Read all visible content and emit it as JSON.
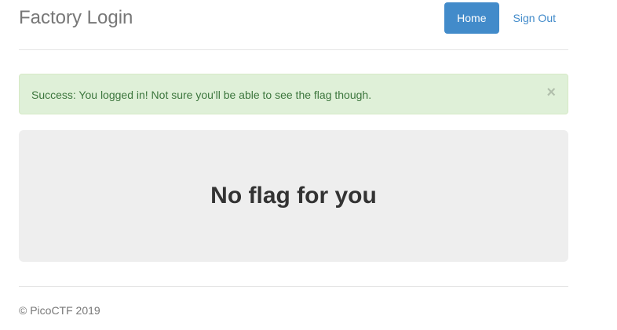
{
  "header": {
    "title": "Factory Login",
    "nav": {
      "home_label": "Home",
      "signout_label": "Sign Out"
    }
  },
  "alert": {
    "message": "Success: You logged in! Not sure you'll be able to see the flag though.",
    "close_symbol": "×",
    "type": "success"
  },
  "main": {
    "heading": "No flag for you"
  },
  "footer": {
    "text": "© PicoCTF 2019"
  },
  "colors": {
    "primary": "#428bca",
    "alert_bg": "#dff0d8",
    "alert_text": "#3c763d",
    "jumbotron_bg": "#eeeeee"
  }
}
